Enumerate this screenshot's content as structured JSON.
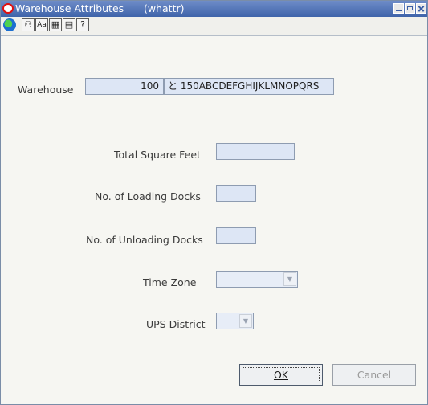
{
  "window": {
    "title": "Warehouse Attributes",
    "module": "(whattr)"
  },
  "toolbar": {
    "icons": [
      "globe-icon",
      "record-icon",
      "find-icon",
      "save-icon",
      "print-icon",
      "help-icon"
    ]
  },
  "form": {
    "warehouse": {
      "label": "Warehouse",
      "id_value": "100",
      "name_value": "と 150ABCDEFGHIJKLMNOPQRS"
    },
    "total_square_feet": {
      "label": "Total Square Feet",
      "value": ""
    },
    "loading_docks": {
      "label": "No. of Loading Docks",
      "value": ""
    },
    "unloading_docks": {
      "label": "No. of Unloading Docks",
      "value": ""
    },
    "time_zone": {
      "label": "Time Zone",
      "value": ""
    },
    "ups_district": {
      "label": "UPS District",
      "value": ""
    }
  },
  "buttons": {
    "ok": "OK",
    "cancel": "Cancel"
  },
  "colors": {
    "title_bar": "#4a6db3",
    "field_bg": "#dde6f5",
    "window_bg": "#f6f6f2"
  }
}
